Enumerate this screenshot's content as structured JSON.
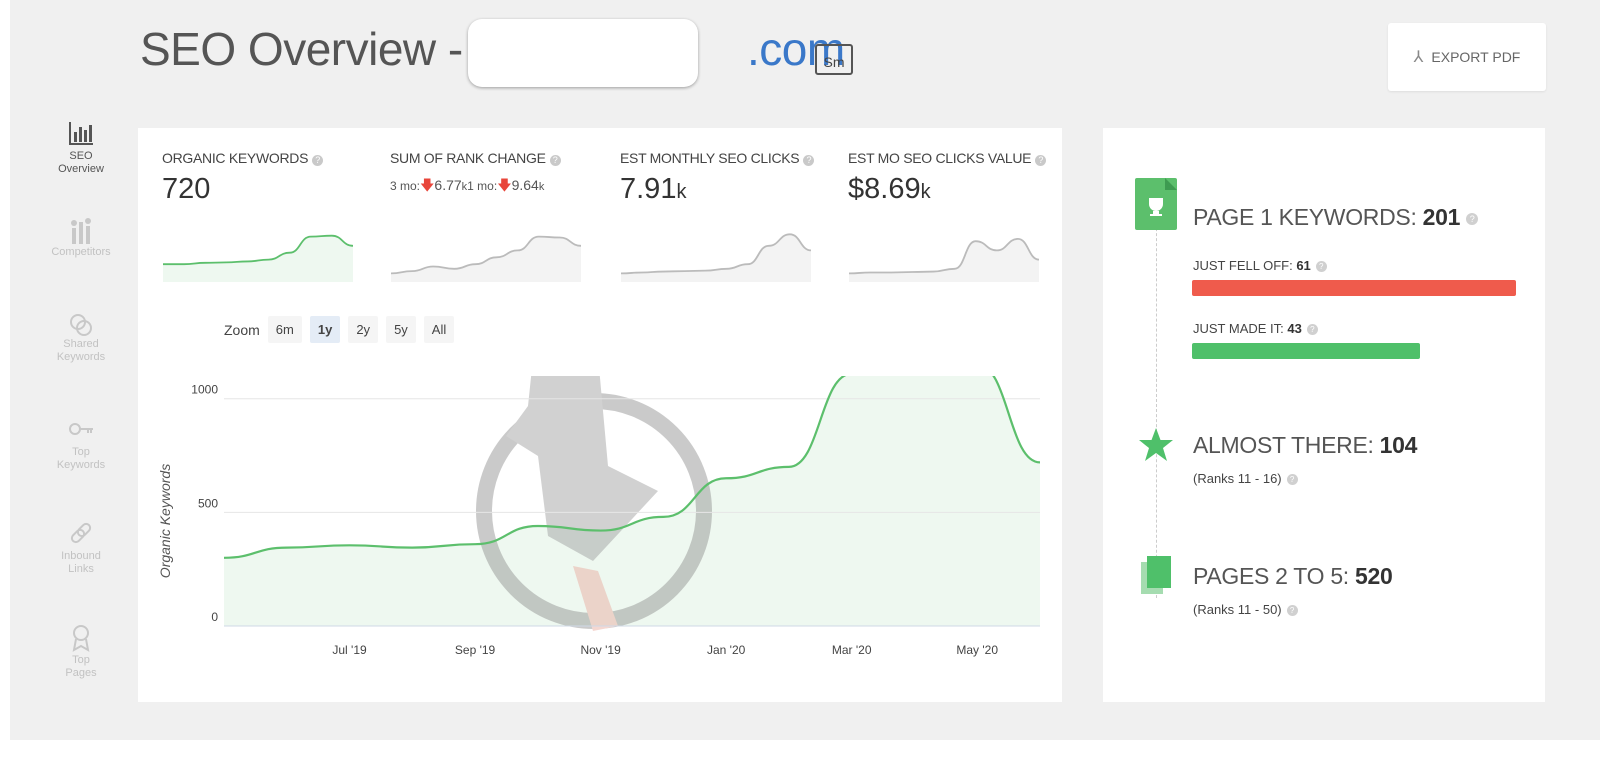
{
  "header": {
    "title_prefix": "SEO Overview - ",
    "domain_suffix": ".com",
    "badge": "Sm",
    "export_label": "EXPORT PDF"
  },
  "sidebar": {
    "items": [
      {
        "label": "SEO Overview",
        "icon": "bar-chart-icon",
        "active": true
      },
      {
        "label": "Competitors",
        "icon": "competitors-icon",
        "active": false
      },
      {
        "label": "Shared Keywords",
        "icon": "shared-keywords-icon",
        "active": false
      },
      {
        "label": "Top Keywords",
        "icon": "key-icon",
        "active": false
      },
      {
        "label": "Inbound Links",
        "icon": "link-icon",
        "active": false
      },
      {
        "label": "Top Pages",
        "icon": "pages-icon",
        "active": false
      }
    ]
  },
  "metrics": [
    {
      "label": "ORGANIC KEYWORDS",
      "value": "720",
      "unit": ""
    },
    {
      "label": "SUM OF RANK CHANGE",
      "rank_text_1": "3 mo:",
      "rank_val_1": "6.77",
      "rank_unit_1": "k",
      "rank_text_2": "1 mo:",
      "rank_val_2": "9.64",
      "rank_unit_2": "k"
    },
    {
      "label": "EST MONTHLY SEO CLICKS",
      "value": "7.91",
      "unit": "k"
    },
    {
      "label": "EST MO SEO CLICKS VALUE",
      "value": "$8.69",
      "unit": "k"
    }
  ],
  "zoom": {
    "label": "Zoom",
    "options": [
      "6m",
      "1y",
      "2y",
      "5y",
      "All"
    ],
    "selected": "1y"
  },
  "chart_data": {
    "type": "area",
    "ylabel": "Organic Keywords",
    "xlabel": "",
    "x_ticks": [
      "Jul '19",
      "Sep '19",
      "Nov '19",
      "Jan '20",
      "Mar '20",
      "May '20"
    ],
    "y_ticks": [
      0,
      500,
      1000
    ],
    "ylim": [
      0,
      1100
    ],
    "x": [
      "May '19",
      "Jun '19",
      "Jul '19",
      "Aug '19",
      "Sep '19",
      "Oct '19",
      "Nov '19",
      "Dec '19",
      "Jan '20",
      "Feb '20",
      "Mar '20",
      "Apr '20",
      "May '20",
      "Jun '20"
    ],
    "series": [
      {
        "values": [
          300,
          345,
          355,
          345,
          360,
          440,
          420,
          480,
          650,
          700,
          1110,
          1130,
          1150,
          720
        ]
      }
    ],
    "color": "#5cbf6c",
    "fill": "#eef8f0",
    "grid": true
  },
  "sparklines": [
    [
      30,
      30,
      33,
      34,
      36,
      40,
      55,
      90,
      92,
      70
    ],
    [
      10,
      15,
      25,
      20,
      30,
      45,
      60,
      90,
      88,
      70
    ],
    [
      10,
      12,
      14,
      15,
      16,
      20,
      30,
      70,
      95,
      60
    ],
    [
      10,
      12,
      12,
      13,
      14,
      20,
      80,
      60,
      85,
      40
    ]
  ],
  "right": {
    "page1": {
      "label": "PAGE 1 KEYWORDS:",
      "value": "201"
    },
    "fell_off": {
      "label": "JUST FELL OFF:",
      "value": "61",
      "fraction": 1.0,
      "color": "#ef5b4c"
    },
    "made_it": {
      "label": "JUST MADE IT:",
      "value": "43",
      "fraction": 0.705,
      "color": "#4fc06a"
    },
    "almost": {
      "label": "ALMOST THERE:",
      "value": "104",
      "sub": "(Ranks 11 - 16)"
    },
    "pages2to5": {
      "label": "PAGES 2 TO 5:",
      "value": "520",
      "sub": "(Ranks 11 - 50)"
    }
  }
}
